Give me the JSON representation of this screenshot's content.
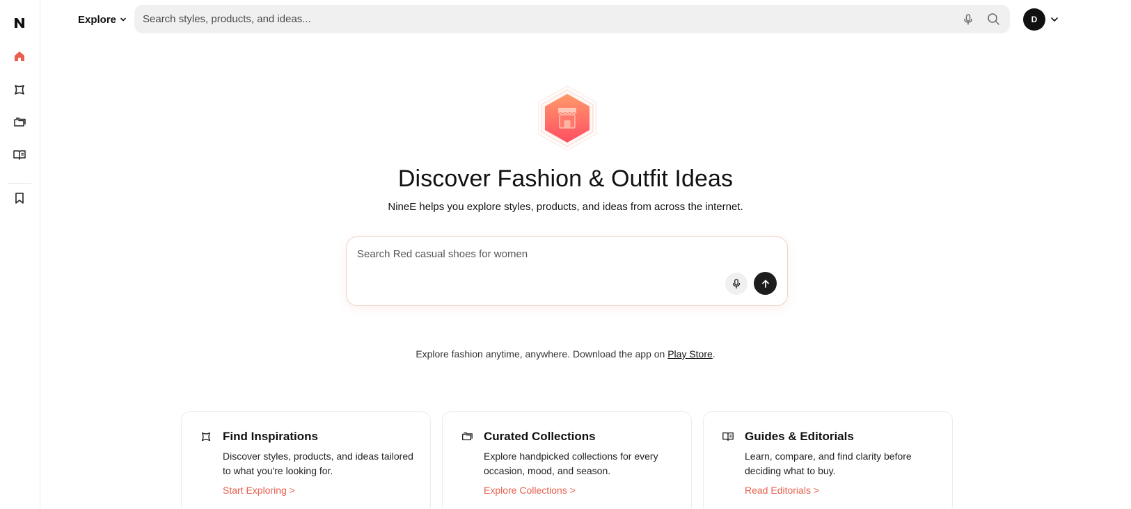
{
  "colors": {
    "accent": "#ec5f4f",
    "brand_gradient_start": "#ff9a6a",
    "brand_gradient_end": "#ff4e62",
    "text": "#111111"
  },
  "rail": {
    "logo_icon": "brand-n-logo",
    "items": [
      {
        "name": "home",
        "icon": "home-icon",
        "active": true
      },
      {
        "name": "inspirations",
        "icon": "sparkle-icon"
      },
      {
        "name": "collections",
        "icon": "folders-icon"
      },
      {
        "name": "guides",
        "icon": "open-book-icon"
      },
      {
        "name": "saved",
        "icon": "bookmark-icon"
      }
    ]
  },
  "header": {
    "explore_label": "Explore",
    "search_placeholder": "Search styles, products, and ideas...",
    "avatar_initial": "D"
  },
  "hero": {
    "icon": "storefront-icon",
    "title": "Discover Fashion & Outfit Ideas",
    "subtitle": "NineE helps you explore styles, products, and ideas from across the internet."
  },
  "main_search": {
    "placeholder": "Search Red casual shoes for women"
  },
  "download": {
    "text": "Explore fashion anytime, anywhere. Download the app on ",
    "link": "Play Store",
    "suffix": "."
  },
  "cards": [
    {
      "icon": "sparkle-icon",
      "title": "Find Inspirations",
      "description": "Discover styles, products, and ideas tailored to what you're looking for.",
      "link": "Start Exploring >"
    },
    {
      "icon": "folders-icon",
      "title": "Curated Collections",
      "description": "Explore handpicked collections for every occasion, mood, and season.",
      "link": "Explore Collections >"
    },
    {
      "icon": "open-book-icon",
      "title": "Guides & Editorials",
      "description": "Learn, compare, and find clarity before deciding what to buy.",
      "link": "Read Editorials >"
    }
  ]
}
